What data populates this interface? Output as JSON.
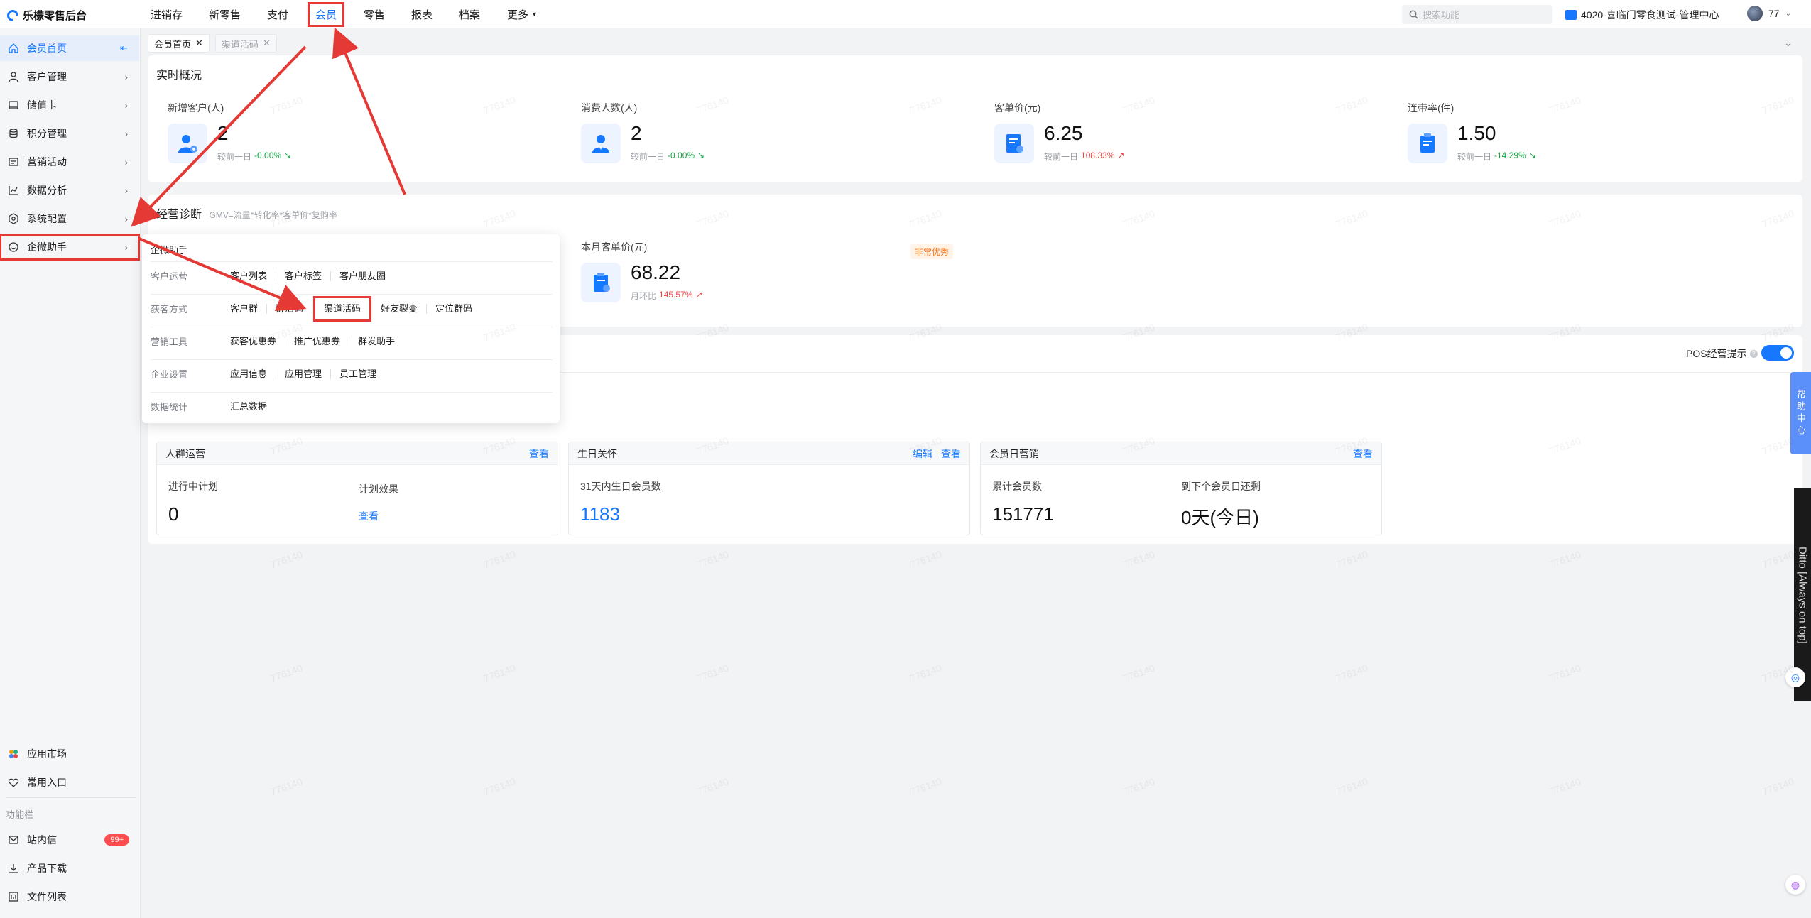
{
  "app": {
    "title": "乐檬零售后台"
  },
  "topnav": [
    {
      "label": "进销存",
      "highlight": false
    },
    {
      "label": "新零售",
      "highlight": false
    },
    {
      "label": "支付",
      "highlight": false
    },
    {
      "label": "会员",
      "highlight": true
    },
    {
      "label": "零售",
      "highlight": false
    },
    {
      "label": "报表",
      "highlight": false
    },
    {
      "label": "档案",
      "highlight": false
    },
    {
      "label": "更多",
      "highlight": false
    }
  ],
  "search": {
    "placeholder": "搜索功能"
  },
  "store": {
    "label": "4020-喜临门零食测试-管理中心"
  },
  "user": {
    "name": "77"
  },
  "sidebar": {
    "items": [
      {
        "label": "会员首页",
        "icon": "home-icon"
      },
      {
        "label": "客户管理",
        "icon": "user-icon"
      },
      {
        "label": "储值卡",
        "icon": "card-icon"
      },
      {
        "label": "积分管理",
        "icon": "coins-icon"
      },
      {
        "label": "营销活动",
        "icon": "megaphone-icon"
      },
      {
        "label": "数据分析",
        "icon": "chart-icon"
      },
      {
        "label": "系统配置",
        "icon": "gear-icon"
      },
      {
        "label": "企微助手",
        "icon": "chat-icon"
      }
    ],
    "bottom": [
      {
        "label": "应用市场",
        "icon": "apps-icon"
      },
      {
        "label": "常用入口",
        "icon": "heart-icon"
      }
    ],
    "section_label": "功能栏",
    "tools": [
      {
        "label": "站内信",
        "icon": "mail-icon",
        "badge": "99+"
      },
      {
        "label": "产品下载",
        "icon": "download-icon"
      },
      {
        "label": "文件列表",
        "icon": "file-icon"
      }
    ]
  },
  "tabs": [
    {
      "label": "会员首页",
      "active": true
    },
    {
      "label": "渠道活码",
      "active": false
    }
  ],
  "overview": {
    "title": "实时概况",
    "metrics": [
      {
        "label": "新增客户(人)",
        "value": "2",
        "cmp_label": "较前一日",
        "cmp_value": "-0.00%",
        "trend": "down"
      },
      {
        "label": "消费人数(人)",
        "value": "2",
        "cmp_label": "较前一日",
        "cmp_value": "-0.00%",
        "trend": "down"
      },
      {
        "label": "客单价(元)",
        "value": "6.25",
        "cmp_label": "较前一日",
        "cmp_value": "108.33%",
        "trend": "up"
      },
      {
        "label": "连带率(件)",
        "value": "1.50",
        "cmp_label": "较前一日",
        "cmp_value": "-14.29%",
        "trend": "down"
      }
    ]
  },
  "diagnosis": {
    "title": "经营诊断",
    "formula": "GMV=流量*转化率*客单价*复购率",
    "metric": {
      "label": "本月客单价(元)",
      "value": "68.22",
      "cmp_label": "月环比",
      "cmp_value": "145.57%"
    },
    "tag": "非常优秀"
  },
  "pos_tip": {
    "label": "POS经营提示"
  },
  "popup": {
    "title": "企微助手",
    "rows": [
      {
        "category": "客户运营",
        "links": [
          "客户列表",
          "客户标签",
          "客户朋友圈"
        ],
        "highlight": ""
      },
      {
        "category": "获客方式",
        "links": [
          "客户群",
          "群活码",
          "渠道活码",
          "好友裂变",
          "定位群码"
        ],
        "highlight": "渠道活码"
      },
      {
        "category": "营销工具",
        "links": [
          "获客优惠券",
          "推广优惠券",
          "群发助手"
        ],
        "highlight": ""
      },
      {
        "category": "企业设置",
        "links": [
          "应用信息",
          "应用管理",
          "员工管理"
        ],
        "highlight": ""
      },
      {
        "category": "数据统计",
        "links": [
          "汇总数据"
        ],
        "highlight": ""
      }
    ]
  },
  "cards": {
    "crowd": {
      "title": "人群运营",
      "action": "查看",
      "plan_label": "进行中计划",
      "plan_value": "0",
      "effect_label": "计划效果",
      "effect_link": "查看"
    },
    "birthday": {
      "title": "生日关怀",
      "action_edit": "编辑",
      "action_view": "查看",
      "label": "31天内生日会员数",
      "value": "1183"
    },
    "memberday": {
      "title": "会员日营销",
      "action": "查看",
      "total_label": "累计会员数",
      "total_value": "151771",
      "next_label": "到下个会员日还剩",
      "next_value": "0天(今日)"
    }
  },
  "float": {
    "help": "帮助中心",
    "ditto": "Ditto [Always on top]"
  },
  "watermark": "776140",
  "colors": {
    "accent": "#1677ff",
    "highlight_box": "#e53935",
    "up": "#ef4444",
    "down": "#10a544"
  }
}
